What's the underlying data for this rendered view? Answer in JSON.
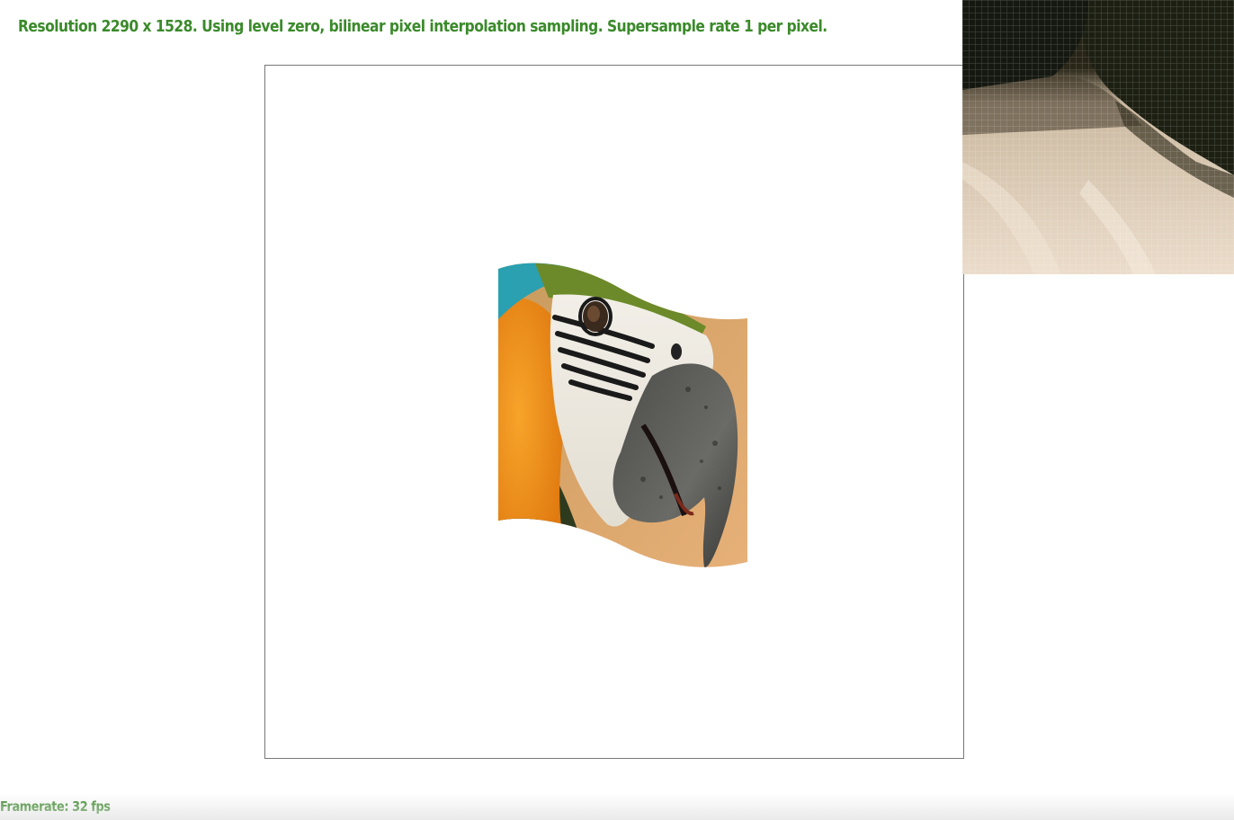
{
  "status": {
    "resolution_text": "Resolution 2290 x 1528. Using level zero, bilinear pixel interpolation sampling. Supersample rate 1 per pixel."
  },
  "footer": {
    "framerate_text": "Framerate: 32 fps"
  },
  "colors": {
    "label_green": "#3a8a2a",
    "viewport_border": "#777777"
  },
  "icons": {
    "texture": "textured-parrot-image",
    "magnifier": "pixel-zoom-inset"
  }
}
